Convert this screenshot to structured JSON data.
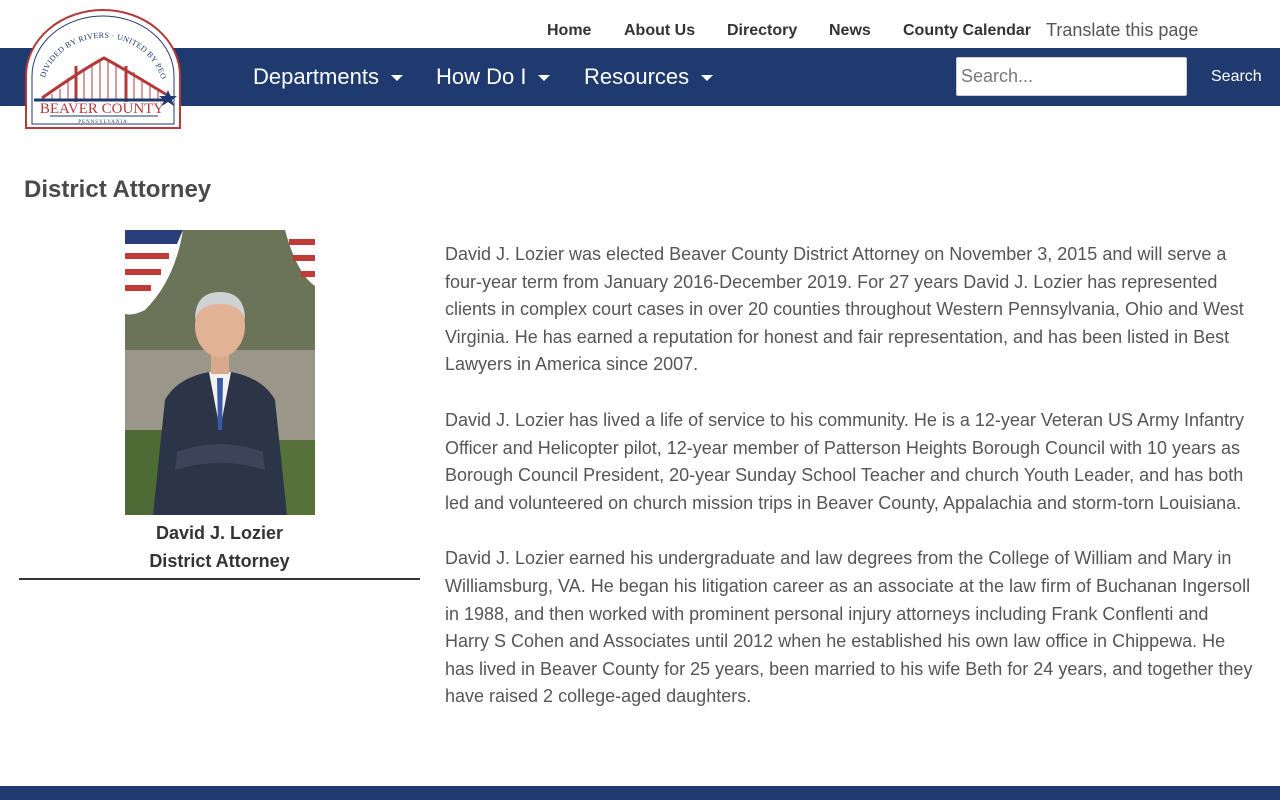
{
  "utility_nav": {
    "links": [
      "Home",
      "About Us",
      "Directory",
      "News",
      "County Calendar"
    ],
    "translate": "Translate this page"
  },
  "logo": {
    "top_arc": "DIVIDED BY RIVERS · UNITED BY PEOPLE",
    "name": "BEAVER COUNTY",
    "state": "PENNSYLVANIA"
  },
  "main_nav": {
    "items": [
      "Departments",
      "How Do I",
      "Resources"
    ],
    "search_placeholder": "Search...",
    "search_button": "Search"
  },
  "page": {
    "title": "District Attorney"
  },
  "profile": {
    "name": "David J. Lozier",
    "role": "District Attorney"
  },
  "bio": {
    "paragraphs": [
      "David J. Lozier was elected Beaver County District Attorney on November 3, 2015 and will serve a four-year term from January 2016-December 2019. For 27 years David J. Lozier has represented clients in complex court cases in over 20 counties throughout Western Pennsylvania, Ohio and West Virginia. He has earned a reputation for honest and fair representation, and has been listed in Best Lawyers in America since 2007.",
      "David J. Lozier has lived a life of service to his community. He is a 12-year Veteran US Army Infantry Officer and Helicopter pilot, 12-year member of Patterson Heights Borough Council with 10 years as Borough Council President, 20-year Sunday School Teacher and church Youth Leader, and has both led and volunteered on church mission trips in Beaver County, Appalachia and storm-torn Louisiana.",
      "David J. Lozier earned his undergraduate and law degrees from the College of William and Mary in Williamsburg, VA. He began his litigation career as an associate at the law firm of Buchanan Ingersoll in 1988, and then worked with prominent personal injury attorneys including Frank Conflenti and Harry S Cohen and Associates until 2012 when he established his own law office in Chippewa. He has lived in Beaver County for 25 years, been married to his wife Beth for 24 years, and together they have raised 2 college-aged daughters."
    ]
  },
  "colors": {
    "nav_background": "#1f3a6e",
    "logo_red": "#b23a3a",
    "logo_navy": "#1f3a6e"
  }
}
